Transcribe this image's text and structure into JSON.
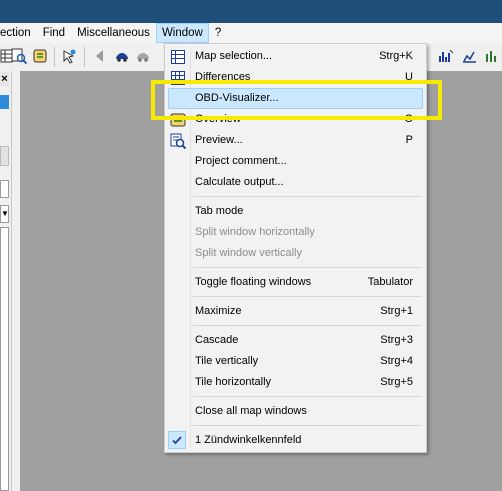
{
  "menubar": {
    "items": [
      "ection",
      "Find",
      "Miscellaneous",
      "Window",
      "?"
    ]
  },
  "window_menu": {
    "items": [
      {
        "label": "Map selection...",
        "shortcut": "Strg+K",
        "icon": "map-selection-icon"
      },
      {
        "label": "Differences",
        "shortcut": "U",
        "icon": "grid-icon"
      },
      {
        "label": "OBD-Visualizer...",
        "shortcut": ""
      },
      {
        "label": "Overview",
        "shortcut": "O",
        "icon": "overview-icon"
      },
      {
        "label": "Preview...",
        "shortcut": "P",
        "icon": "preview-icon"
      },
      {
        "label": "Project comment...",
        "shortcut": ""
      },
      {
        "label": "Calculate output...",
        "shortcut": ""
      },
      {
        "label": "Tab mode",
        "shortcut": ""
      },
      {
        "label": "Split window horizontally",
        "shortcut": "",
        "disabled": true
      },
      {
        "label": "Split window vertically",
        "shortcut": "",
        "disabled": true
      },
      {
        "label": "Toggle floating windows",
        "shortcut": "Tabulator"
      },
      {
        "label": "Maximize",
        "shortcut": "Strg+1"
      },
      {
        "label": "Cascade",
        "shortcut": "Strg+3"
      },
      {
        "label": "Tile vertically",
        "shortcut": "Strg+4"
      },
      {
        "label": "Tile horizontally",
        "shortcut": "Strg+5"
      },
      {
        "label": "Close all map windows",
        "shortcut": ""
      },
      {
        "label": "1 Zündwinkelkennfeld",
        "shortcut": "",
        "checked": true
      }
    ]
  },
  "colors": {
    "titlebar": "#1e4f79",
    "workspace": "#a0a0a0",
    "highlight_box": "#f6ea00",
    "menu_hover": "#cce8ff"
  }
}
